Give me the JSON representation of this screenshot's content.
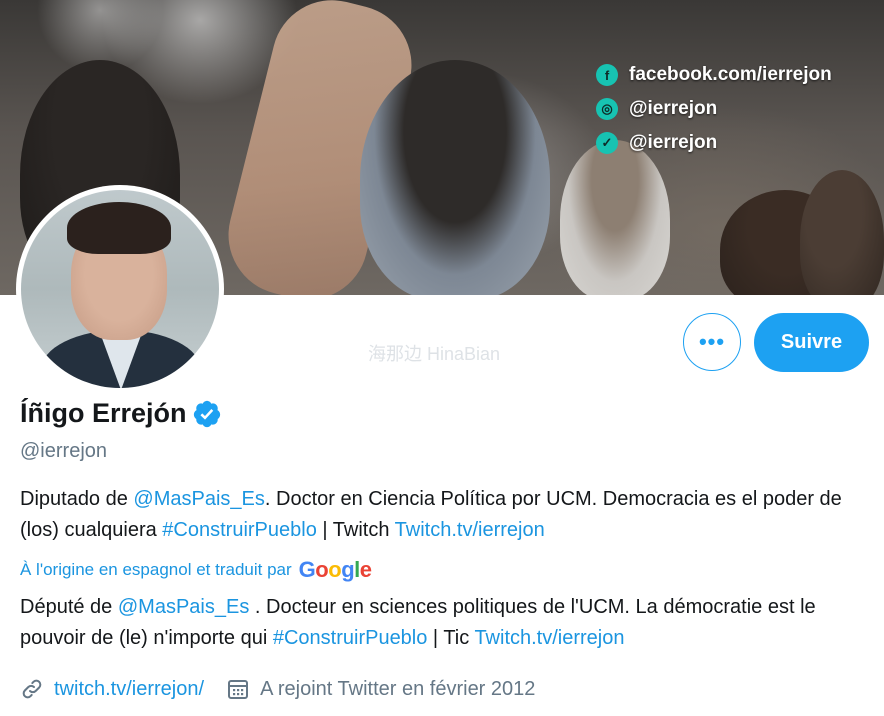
{
  "banner": {
    "social": [
      {
        "icon": "facebook-icon",
        "glyph": "f",
        "text": "facebook.com/ierrejon"
      },
      {
        "icon": "instagram-icon",
        "glyph": "◎",
        "text": "@ierrejon"
      },
      {
        "icon": "twitter-icon",
        "glyph": "✓",
        "text": "@ierrejon"
      }
    ]
  },
  "actions": {
    "more_label": "•••",
    "follow_label": "Suivre"
  },
  "profile": {
    "name": "Íñigo Errejón",
    "handle": "@ierrejon",
    "bio": {
      "p1": "Diputado de ",
      "mention": "@MasPais_Es",
      "p2": ". Doctor en Ciencia Política por UCM. Democracia es el poder de (los) cualquiera ",
      "hashtag": "#ConstruirPueblo",
      "p3": " | Twitch ",
      "twitch": "Twitch.tv/ierrejon"
    },
    "translated_note": "À l'origine en espagnol et traduit par",
    "google": [
      "G",
      "o",
      "o",
      "g",
      "l",
      "e"
    ],
    "bio_fr": {
      "p1": "Député de ",
      "mention": "@MasPais_Es",
      "p2": " . Docteur en sciences politiques de l'UCM. La démocratie est le pouvoir de (le) n'importe qui ",
      "hashtag": "#ConstruirPueblo",
      "p3": " | Tic ",
      "twitch": "Twitch.tv/ierrejon"
    },
    "website": "twitch.tv/ierrejon/",
    "joined": "A rejoint Twitter en février 2012"
  },
  "colors": {
    "accent": "#1da1f2",
    "link": "#1b95e0",
    "secondary_text": "#657786"
  },
  "watermark": "海那边 HinaBian"
}
